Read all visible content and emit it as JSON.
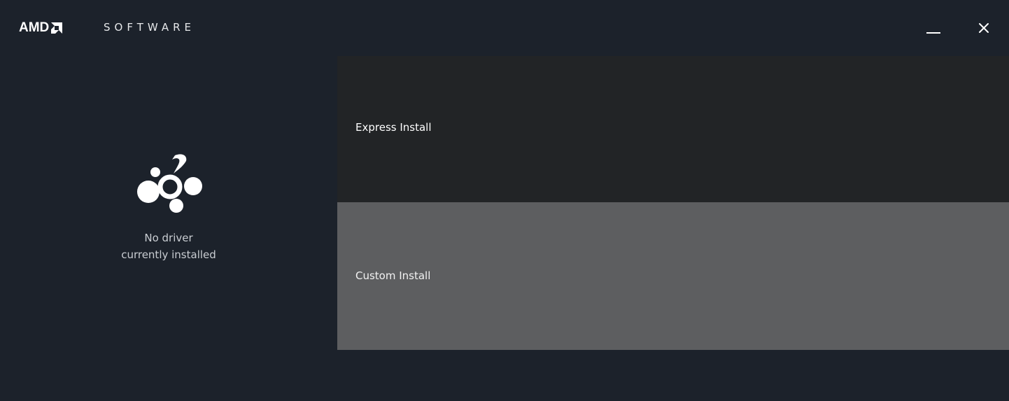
{
  "window": {
    "brand": "AMD",
    "product_name": "SOFTWARE"
  },
  "controls": {
    "minimize_icon": "minimize-icon",
    "close_icon": "close-icon"
  },
  "status": {
    "icon": "no-driver-icon",
    "line1": "No driver",
    "line2": "currently installed"
  },
  "options": {
    "express_label": "Express Install",
    "custom_label": "Custom Install"
  },
  "colors": {
    "background": "#1c222b",
    "express_bg": "#222426",
    "custom_bg": "#5d5e60",
    "text": "#ffffff"
  }
}
